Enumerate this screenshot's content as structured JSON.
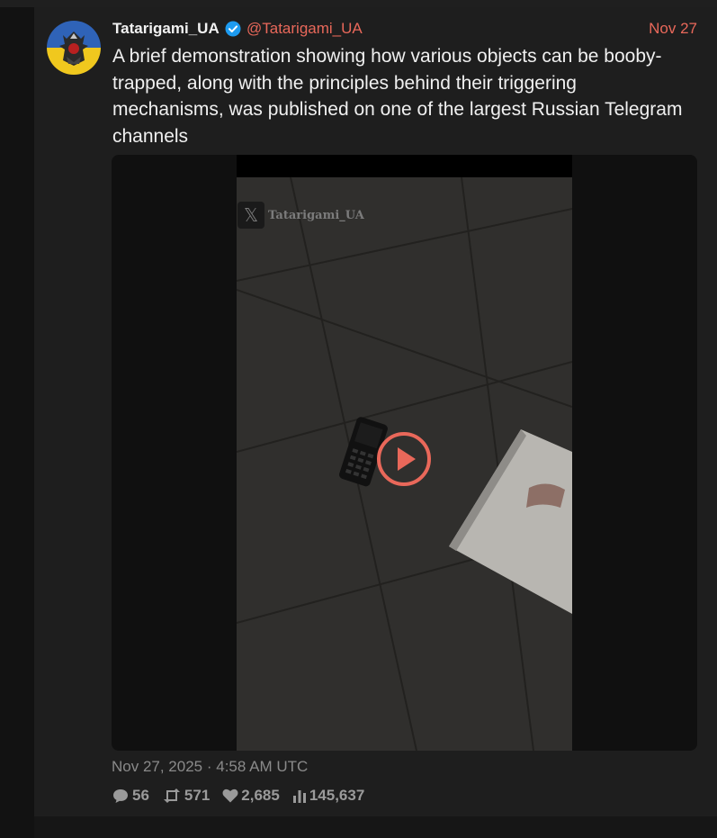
{
  "tweet": {
    "display_name": "Tatarigami_UA",
    "handle": "@Tatarigami_UA",
    "date": "Nov 27",
    "text": "A brief demonstration showing how various objects can be booby-trapped, along with the principles behind their triggering mechanisms, was published on one of the largest Russian Telegram channels",
    "timestamp": "Nov 27, 2025 · 4:58 AM UTC",
    "watermark": "Tatarigami_UA",
    "stats": {
      "replies": "56",
      "retweets": "571",
      "likes": "2,685",
      "views": "145,637"
    }
  },
  "colors": {
    "accent": "#e9685a",
    "verified": "#1d9bf0",
    "background": "#1e1e1e"
  },
  "icons": [
    "verified-badge-icon",
    "x-logo-icon",
    "play-icon",
    "reply-icon",
    "retweet-icon",
    "like-icon",
    "views-icon"
  ]
}
